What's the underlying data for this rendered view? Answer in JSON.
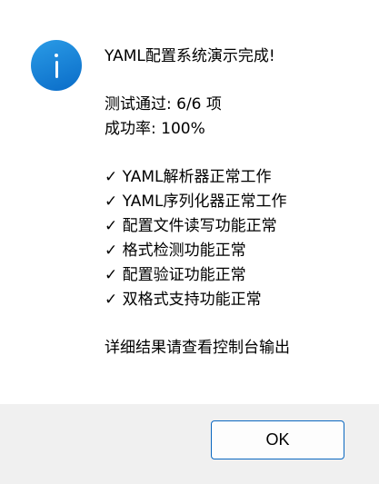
{
  "dialog": {
    "icon": "info-icon",
    "title_line": "YAML配置系统演示完成!",
    "summary": [
      "测试通过: 6/6 项",
      "成功率: 100%"
    ],
    "checks": [
      "✓ YAML解析器正常工作",
      "✓ YAML序列化器正常工作",
      "✓ 配置文件读写功能正常",
      "✓ 格式检测功能正常",
      "✓ 配置验证功能正常",
      "✓ 双格式支持功能正常"
    ],
    "footer_note": "详细结果请查看控制台输出",
    "ok_label": "OK"
  }
}
